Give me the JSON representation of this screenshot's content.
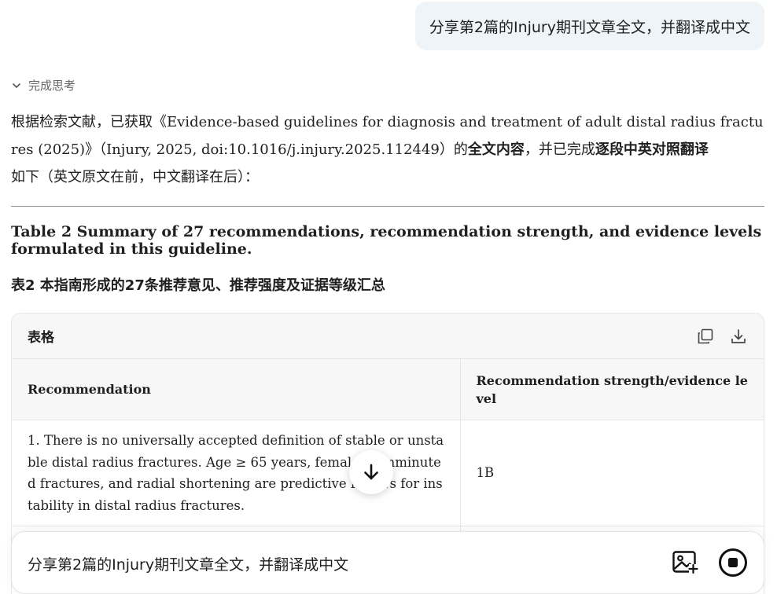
{
  "user_message": "分享第2篇的Injury期刊文章全文，并翻译成中文",
  "thinking": {
    "label": "完成思考",
    "icon": "chevron-down-icon"
  },
  "intro": {
    "part1": "根据检索文献，已获取《Evidence-based guidelines for diagnosis and treatment of adult distal radius fractures (2025)》（Injury, 2025, doi:10.1016/j.injury.2025.112449）的",
    "bold1": "全文内容",
    "part2": "，并已完成",
    "bold2": "逐段中英对照翻译",
    "part3": "如下（英文原文在前，中文翻译在后）："
  },
  "heading_en": "Table 2 Summary of 27 recommendations, recommendation strength, and evidence levels formulated in this guideline.",
  "heading_zh": "表2 本指南形成的27条推荐意见、推荐强度及证据等级汇总",
  "table": {
    "title": "表格",
    "tools": [
      "copy-icon",
      "download-icon"
    ],
    "columns": [
      "Recommendation",
      "Recommendation strength/evidence level"
    ],
    "rows": [
      {
        "recommendation": "1. There is no universally accepted definition of stable or unstable distal radius fractures. Age ≥ 65 years, female, comminuted fractures, and radial shortening are predictive factors for instability in distal radius fractures.",
        "strength": "1B"
      }
    ]
  },
  "scroll_button": {
    "icon": "arrow-down-icon"
  },
  "composer": {
    "text": "分享第2篇的Injury期刊文章全文，并翻译成中文",
    "image_icon": "image-upload-icon",
    "stop_icon": "stop-icon"
  }
}
